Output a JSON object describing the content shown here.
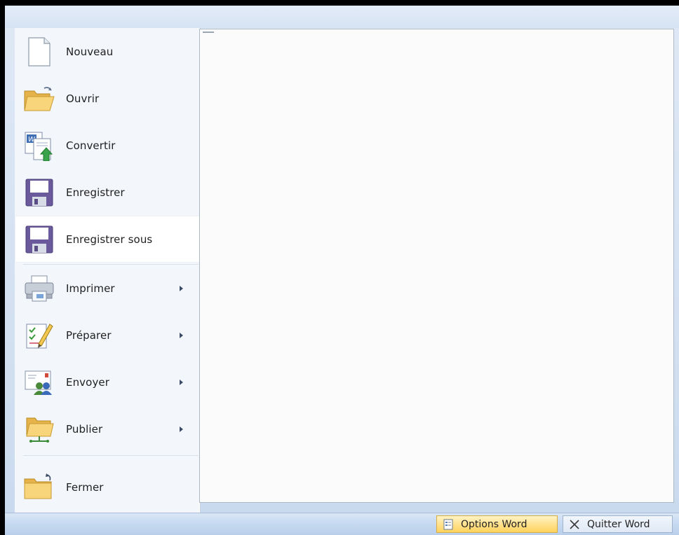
{
  "menu": {
    "items": [
      {
        "label": "Nouveau",
        "icon": "new-document-icon",
        "submenu": false
      },
      {
        "label": "Ouvrir",
        "icon": "open-folder-icon",
        "submenu": false
      },
      {
        "label": "Convertir",
        "icon": "convert-document-icon",
        "submenu": false
      },
      {
        "label": "Enregistrer",
        "icon": "save-floppy-icon",
        "submenu": false
      },
      {
        "label": "Enregistrer sous",
        "icon": "save-as-floppy-icon",
        "submenu": false,
        "highlighted": true
      },
      {
        "label": "Imprimer",
        "icon": "printer-icon",
        "submenu": true
      },
      {
        "label": "Préparer",
        "icon": "prepare-document-icon",
        "submenu": true
      },
      {
        "label": "Envoyer",
        "icon": "send-envelope-icon",
        "submenu": true
      },
      {
        "label": "Publier",
        "icon": "publish-folder-icon",
        "submenu": true
      },
      {
        "label": "Fermer",
        "icon": "close-folder-icon",
        "submenu": false
      }
    ]
  },
  "footer": {
    "options_label": "Options Word",
    "quit_label": "Quitter Word"
  },
  "colors": {
    "highlight_button": "#ffe08a",
    "panel_background": "#f3f6fb",
    "frame_background": "#d3e0f1"
  }
}
